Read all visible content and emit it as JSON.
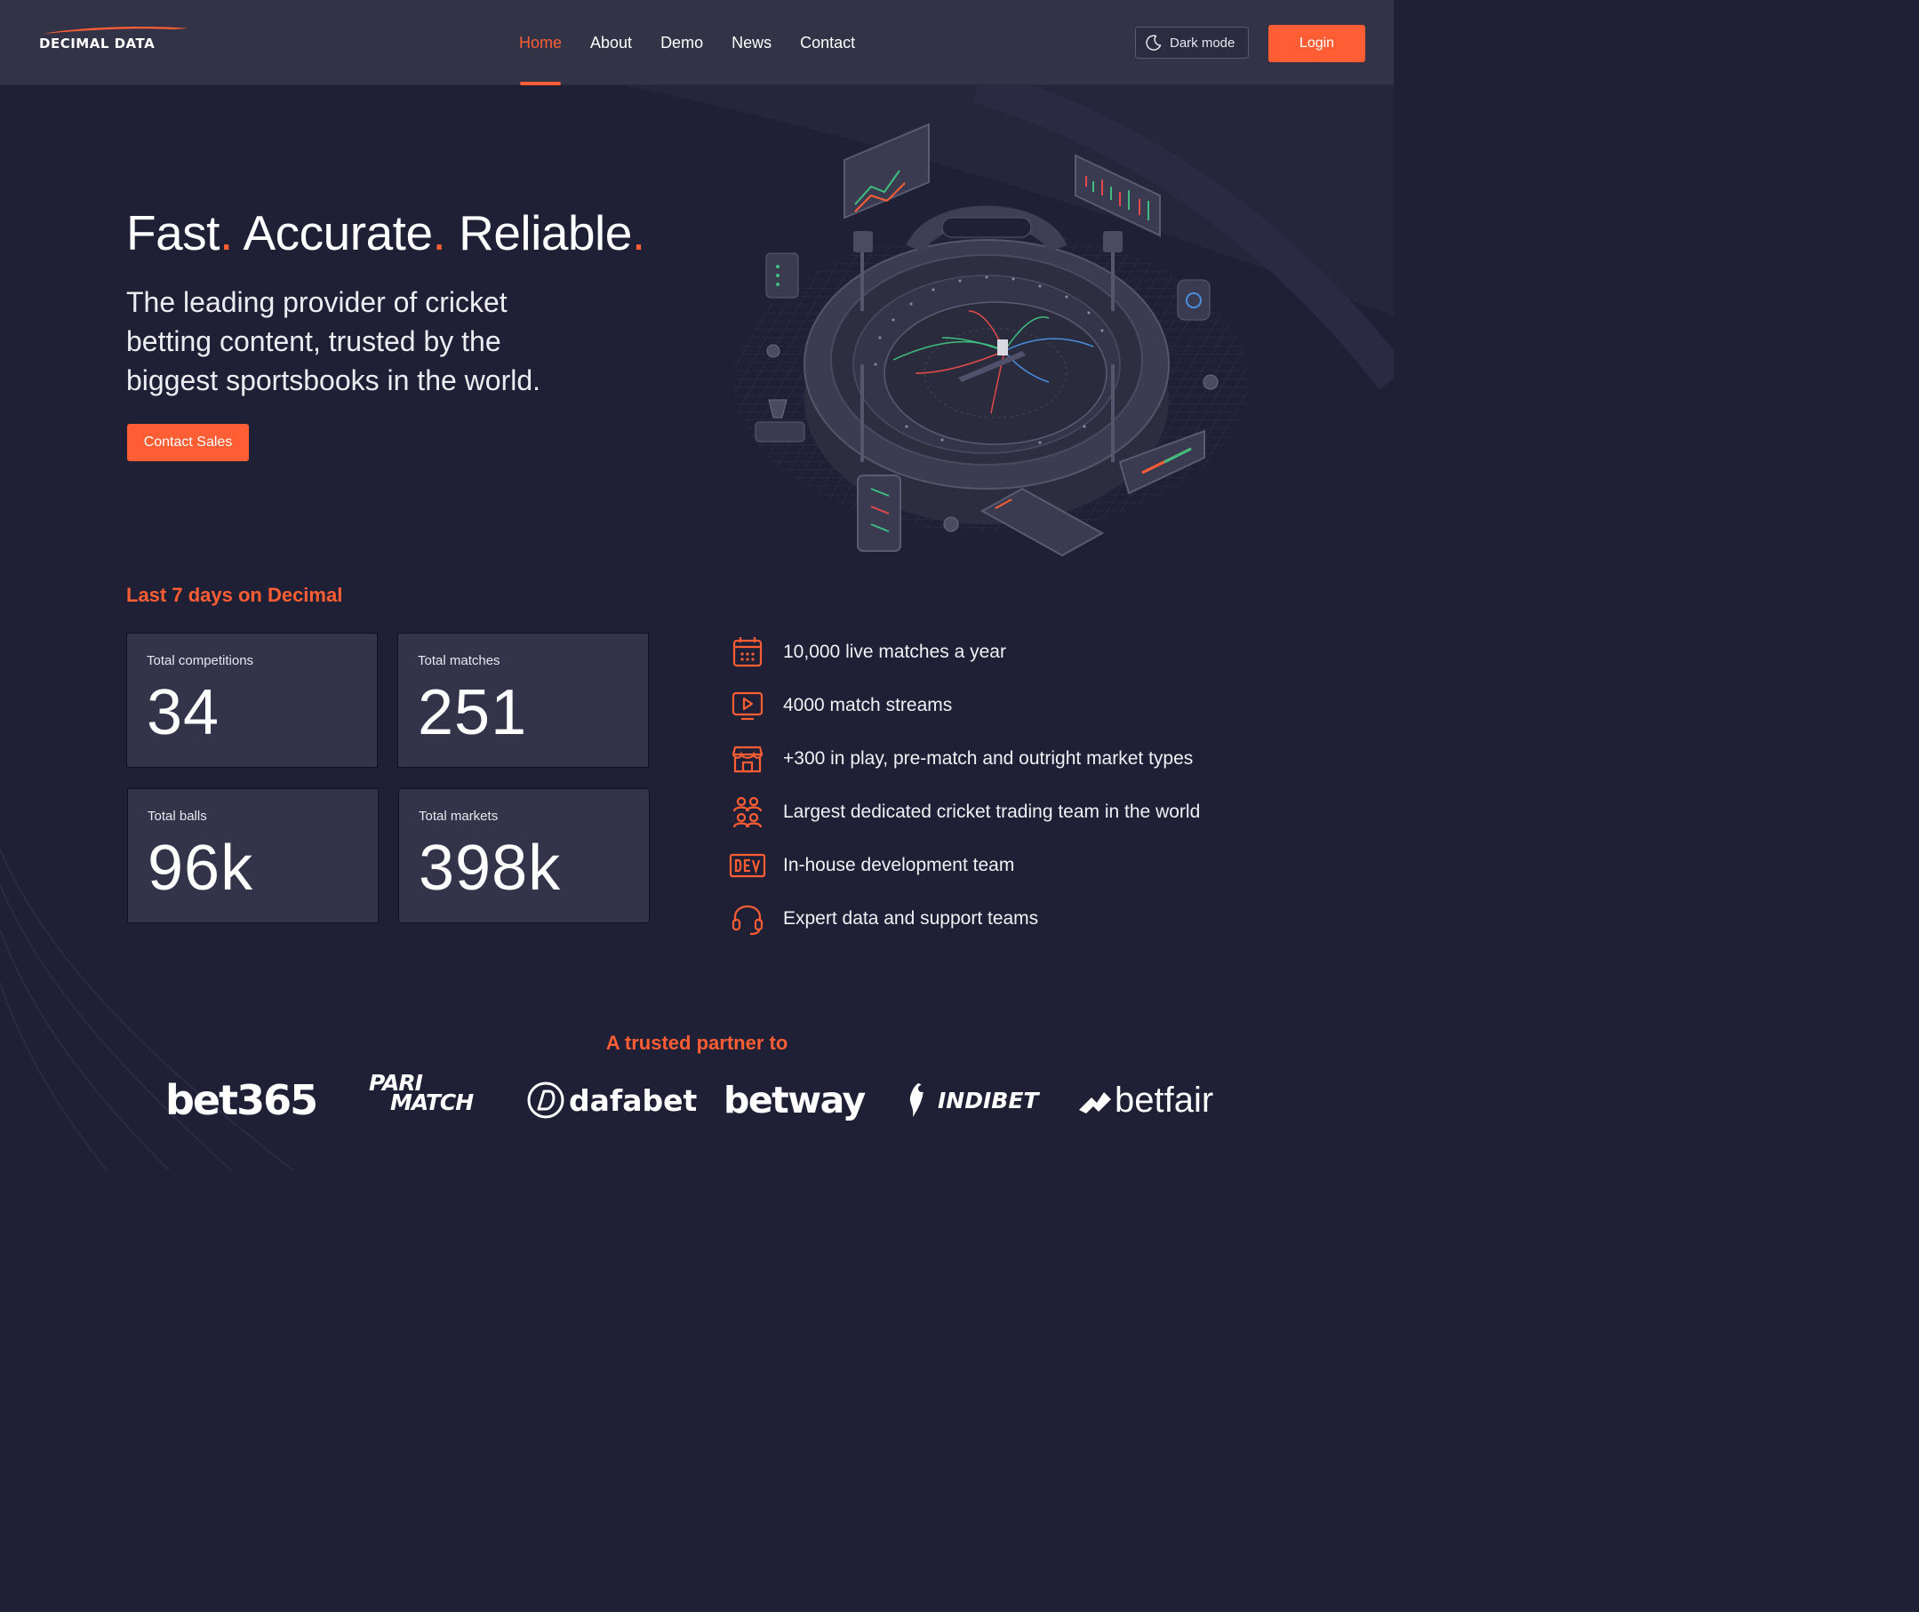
{
  "brand": {
    "name": "DECIMAL DATA",
    "accent": "#ff5e34",
    "background": "#1f2036",
    "navbar_bg": "#323347"
  },
  "nav": {
    "links": [
      {
        "label": "Home",
        "active": true
      },
      {
        "label": "About",
        "active": false
      },
      {
        "label": "Demo",
        "active": false
      },
      {
        "label": "News",
        "active": false
      },
      {
        "label": "Contact",
        "active": false
      }
    ],
    "dark_mode_label": "Dark mode",
    "dark_mode_icon": "moon-icon",
    "login_label": "Login"
  },
  "hero": {
    "title_words": [
      "Fast",
      "Accurate",
      "Reliable"
    ],
    "title_dot": ".",
    "subtitle": "The leading provider of cricket betting content, trusted by the biggest sportsbooks in the world.",
    "cta_label": "Contact Sales"
  },
  "stats": {
    "heading": "Last 7 days on Decimal",
    "cards": [
      {
        "label": "Total competitions",
        "value": "34"
      },
      {
        "label": "Total matches",
        "value": "251"
      },
      {
        "label": "Total balls",
        "value": "96k"
      },
      {
        "label": "Total markets",
        "value": "398k"
      }
    ]
  },
  "features": [
    {
      "icon": "calendar-icon",
      "text": "10,000 live matches a year"
    },
    {
      "icon": "video-play-icon",
      "text": "4000 match streams"
    },
    {
      "icon": "storefront-icon",
      "text": "+300 in play, pre-match  and outright market types"
    },
    {
      "icon": "team-icon",
      "text": "Largest dedicated cricket trading team in the world"
    },
    {
      "icon": "dev-icon",
      "text": "In-house development team"
    },
    {
      "icon": "headset-icon",
      "text": "Expert data and support teams"
    }
  ],
  "partners": {
    "heading": "A trusted partner to",
    "logos": [
      {
        "name": "bet365",
        "text": "bet365"
      },
      {
        "name": "parimatch",
        "line1": "PARI",
        "line2": "MATCH"
      },
      {
        "name": "dafabet",
        "text": "dafabet"
      },
      {
        "name": "betway",
        "text": "betway"
      },
      {
        "name": "indibet",
        "text": "INDIBET"
      },
      {
        "name": "betfair",
        "text": "betfair"
      }
    ]
  }
}
